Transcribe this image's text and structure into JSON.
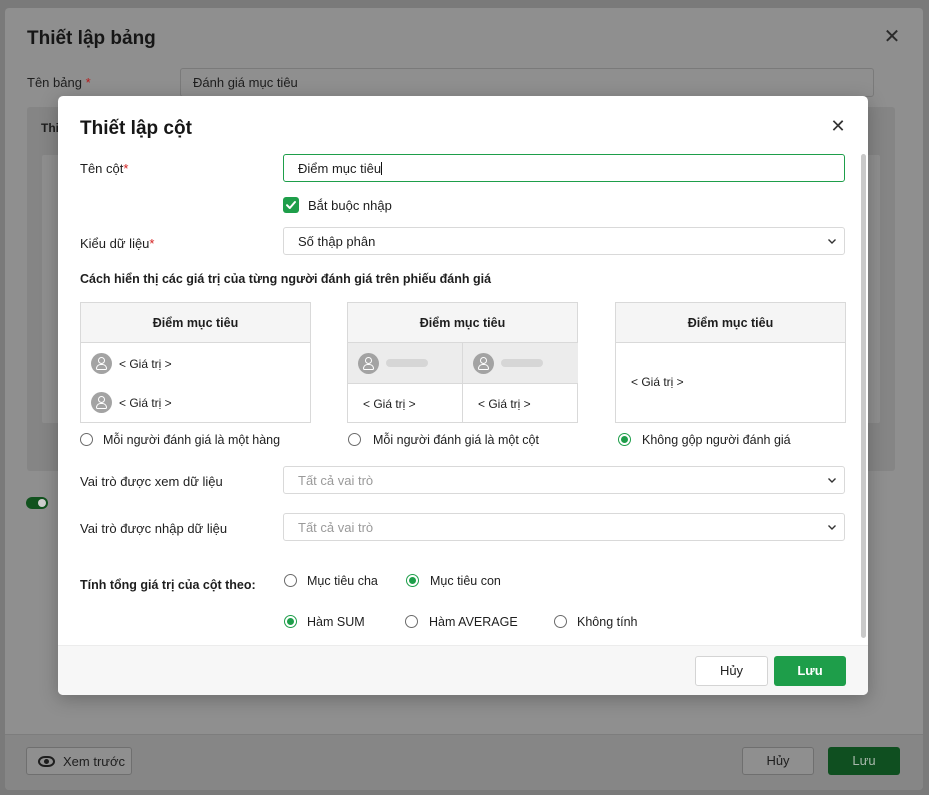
{
  "outer": {
    "title": "Thiết lập bảng",
    "table_name_label": "Tên bảng",
    "required_mark": "*",
    "table_name_value": "Đánh giá mục tiêu",
    "section_text": "Thi",
    "preview_label": "Xem trước",
    "cancel_label": "Hủy",
    "save_label": "Lưu"
  },
  "modal": {
    "title": "Thiết lập cột",
    "column_name_label": "Tên cột",
    "required_mark": "*",
    "column_name_value": "Điểm mục tiêu",
    "required_checkbox_label": "Bắt buộc nhập",
    "data_type_label": "Kiểu dữ liệu",
    "data_type_value": "Số thập phân",
    "display_section_title": "Cách hiển thị các giá trị của từng người đánh giá trên phiếu đánh giá",
    "cards": [
      {
        "header": "Điểm mục tiêu",
        "rows": [
          "< Giá trị >",
          "< Giá trị >"
        ],
        "option_label": "Mỗi người đánh giá là một hàng",
        "selected": false
      },
      {
        "header": "Điểm mục tiêu",
        "cells": [
          "< Giá trị >",
          "< Giá trị >"
        ],
        "option_label": "Mỗi người đánh giá là một cột",
        "selected": false
      },
      {
        "header": "Điểm mục tiêu",
        "value": "< Giá trị >",
        "option_label": "Không gộp người đánh giá",
        "selected": true
      }
    ],
    "view_roles_label": "Vai trò được xem dữ liệu",
    "view_roles_placeholder": "Tất cả vai trò",
    "edit_roles_label": "Vai trò được nhập dữ liệu",
    "edit_roles_placeholder": "Tất cả vai trò",
    "sum_by_label": "Tính tổng giá trị của cột theo:",
    "sum_by_options": [
      {
        "label": "Mục tiêu cha",
        "selected": false
      },
      {
        "label": "Mục tiêu con",
        "selected": true
      }
    ],
    "function_options": [
      {
        "label": "Hàm SUM",
        "selected": true
      },
      {
        "label": "Hàm AVERAGE",
        "selected": false
      },
      {
        "label": "Không tính",
        "selected": false
      }
    ],
    "cancel_label": "Hủy",
    "save_label": "Lưu"
  },
  "colors": {
    "accent": "#1e9e4a",
    "overlay": "#8f8f8f",
    "required": "#d42020"
  },
  "icons": [
    "close-icon",
    "checkmark-icon",
    "chevron-down-icon",
    "user-avatar-icon",
    "eye-icon"
  ]
}
